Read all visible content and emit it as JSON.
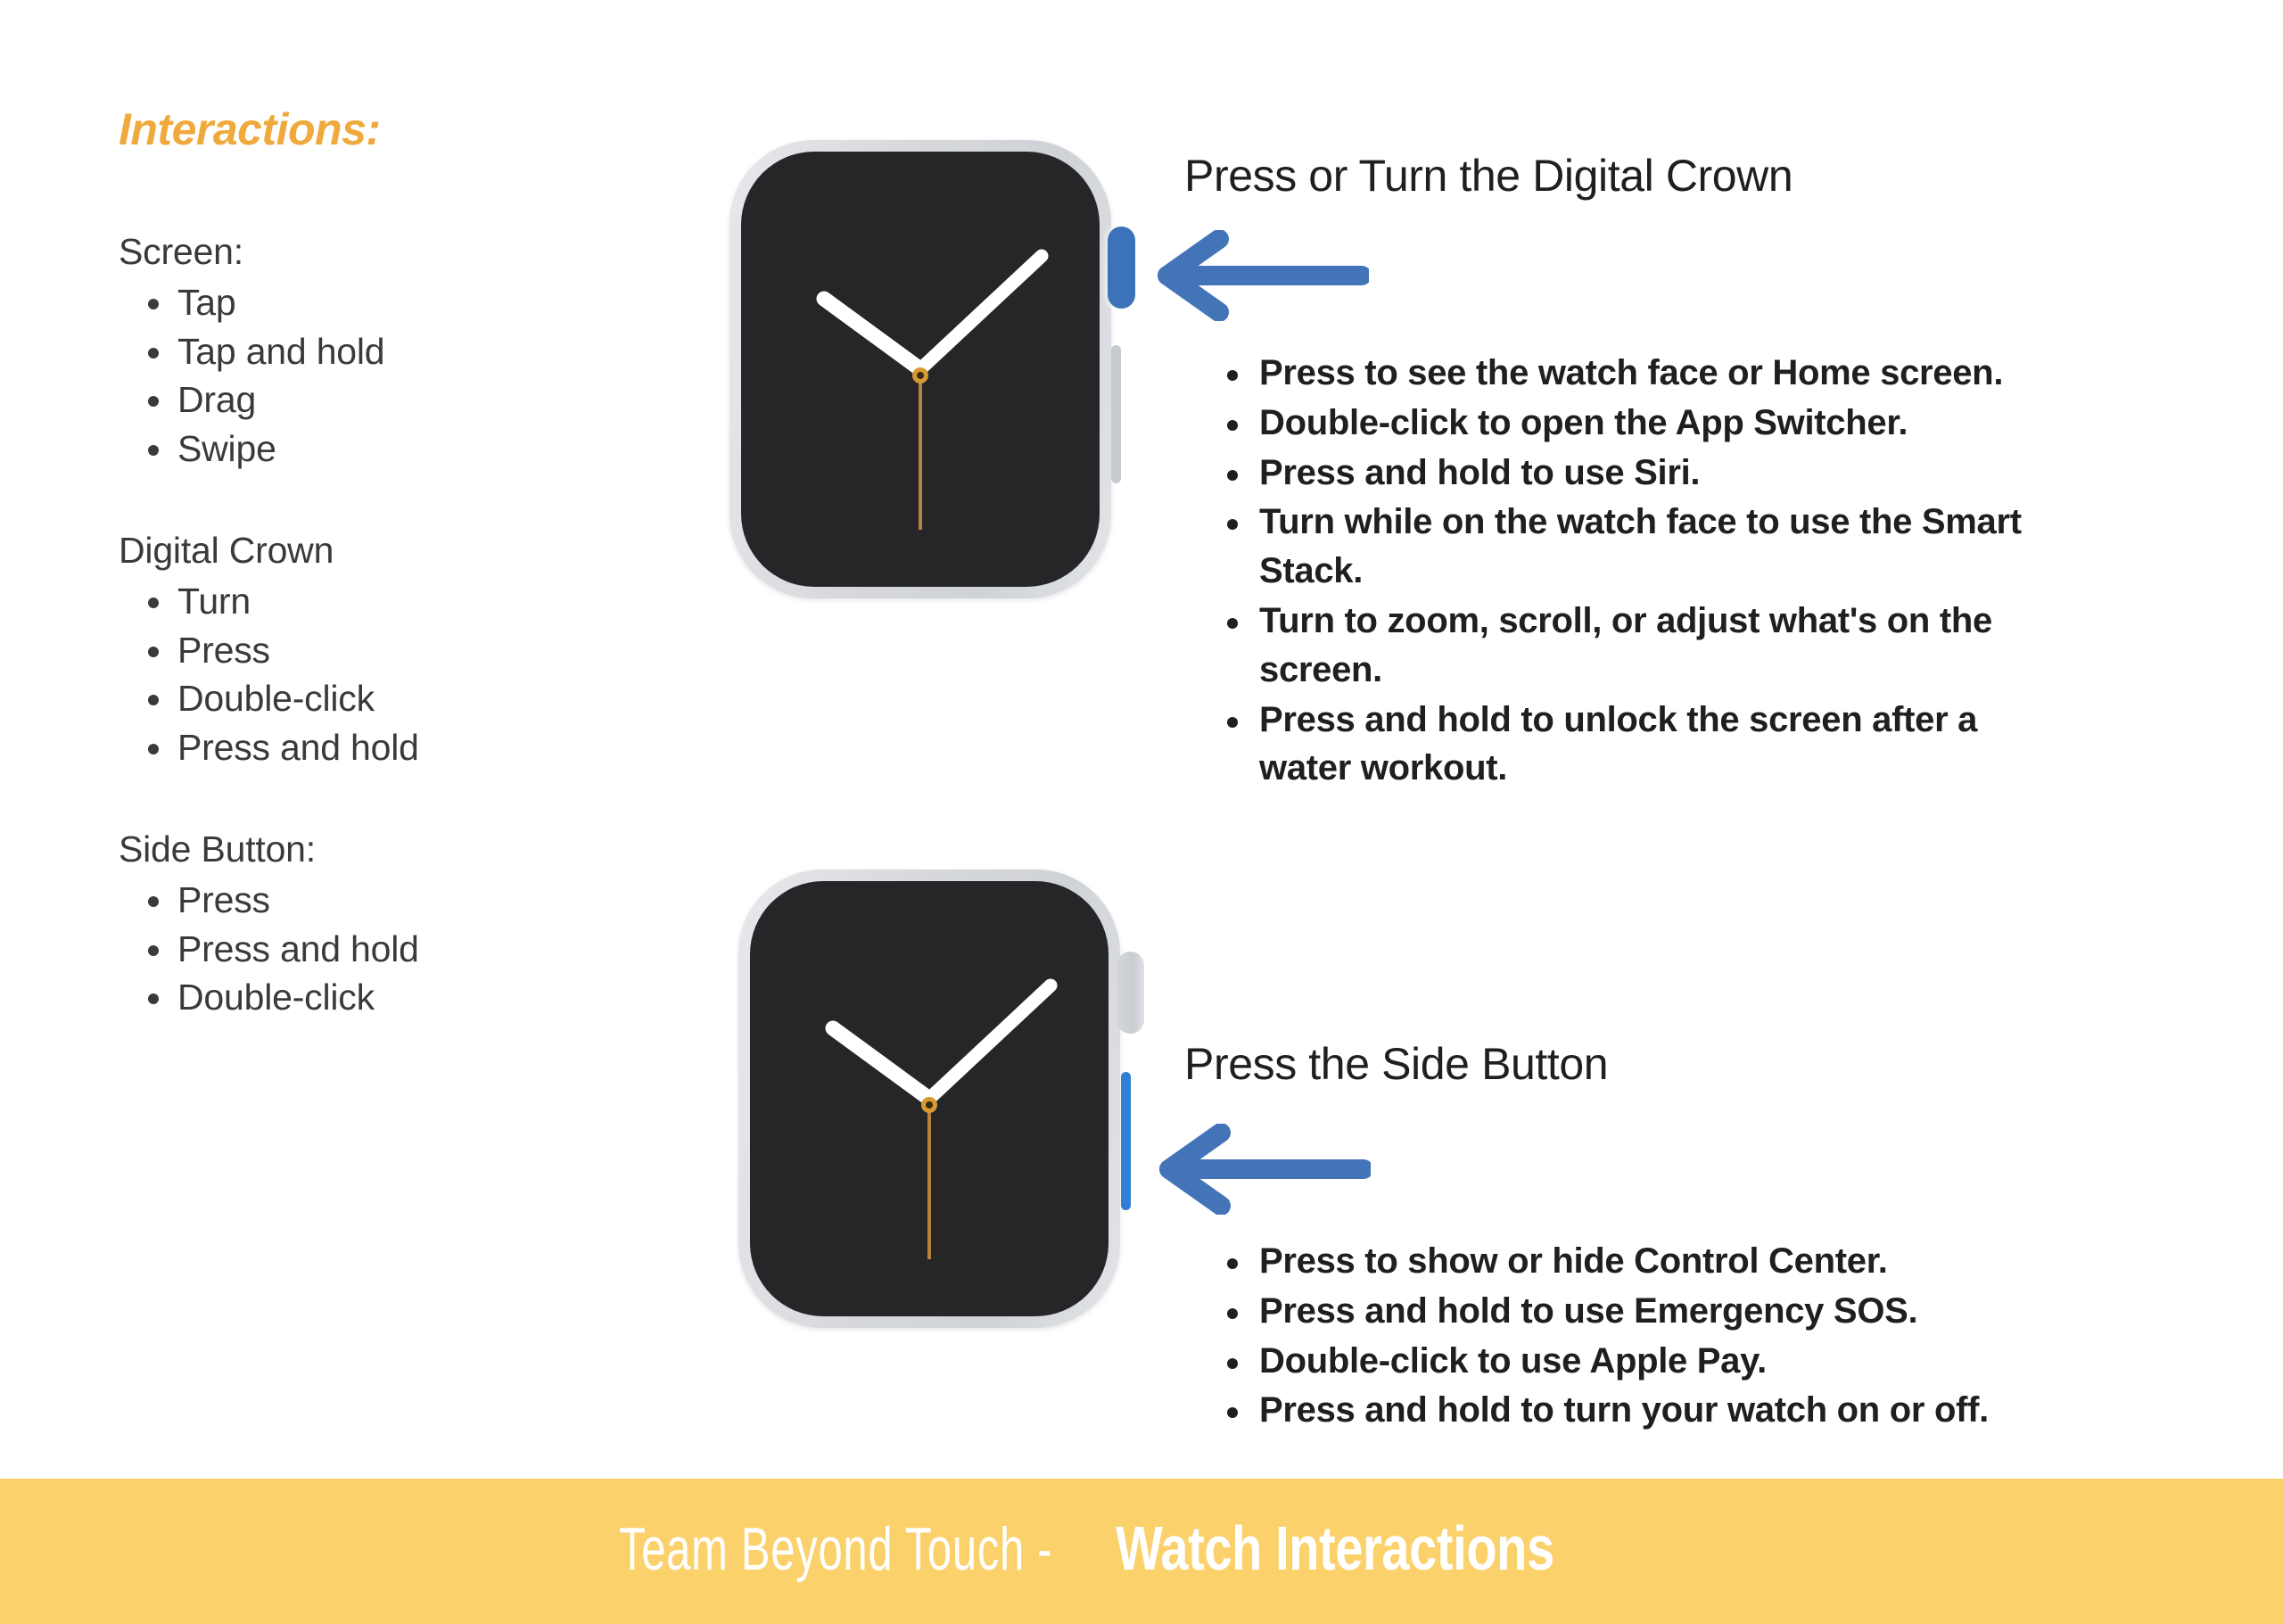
{
  "sidebar": {
    "title": "Interactions:",
    "groups": [
      {
        "label": "Screen:",
        "items": [
          "Tap",
          "Tap and hold",
          "Drag",
          "Swipe"
        ]
      },
      {
        "label": "Digital Crown",
        "items": [
          "Turn",
          "Press",
          "Double-click",
          "Press and hold"
        ]
      },
      {
        "label": "Side Button:",
        "items": [
          "Press",
          "Press and hold",
          "Double-click"
        ]
      }
    ]
  },
  "sections": [
    {
      "heading": "Press or Turn the Digital Crown",
      "bullets": [
        "Press to see the watch face or Home screen.",
        "Double-click to open the App Switcher.",
        "Press and hold to use Siri.",
        "Turn while on the watch face to use the Smart Stack.",
        "Turn to zoom, scroll, or adjust what's on the screen.",
        "Press and hold to unlock the screen after a water workout."
      ]
    },
    {
      "heading": "Press the Side Button",
      "bullets": [
        "Press to show or hide Control Center.",
        "Press and hold to use Emergency SOS.",
        "Double-click to use Apple Pay.",
        "Press and hold to turn your watch on or off."
      ]
    }
  ],
  "footer": {
    "team_label": "Team Beyond Touch - ",
    "title_label": "Watch Interactions"
  },
  "colors": {
    "accent_orange": "#efa93c",
    "footer_bar": "#fbd16b",
    "arrow_blue": "#4374b8",
    "highlight_blue": "#3c72b9",
    "sidebtn_blue": "#2f7fd6",
    "watch_body": "#d7d9dd",
    "watch_screen": "#262628",
    "hand_white": "#ffffff",
    "second_hand_orange": "#c08a3e",
    "body_text": "#3a3a3a",
    "heading_text": "#1f1f1f"
  },
  "watch_face": {
    "icon": "analog-clock-face",
    "hour_hand_angle_deg": -60,
    "minute_hand_angle_deg": 55,
    "second_hand_angle_deg": 180
  }
}
